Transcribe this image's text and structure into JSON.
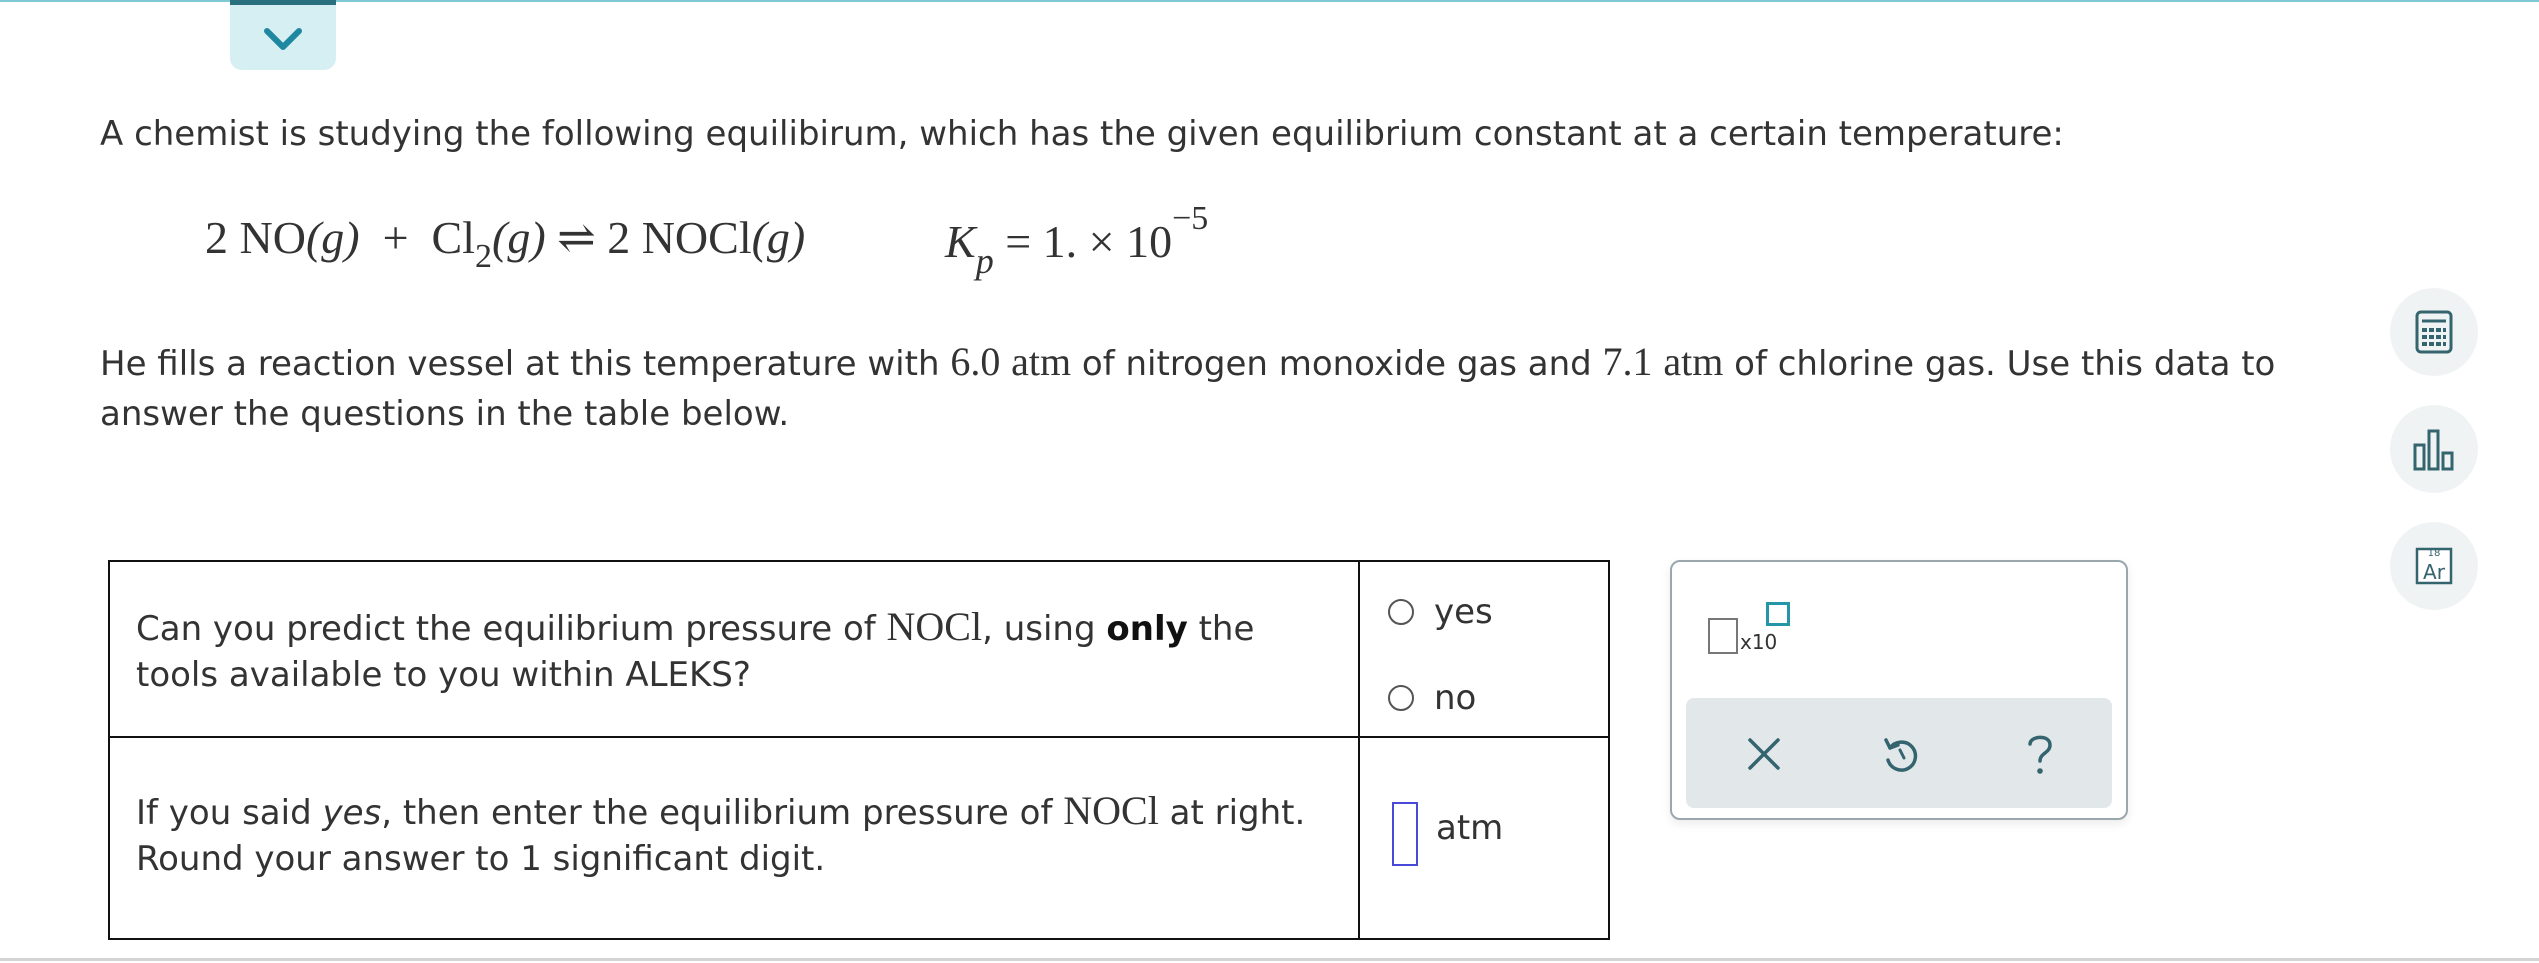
{
  "problem": {
    "intro": "A chemist is studying the following equilibirum, which has the given equilibrium constant at a certain temperature:",
    "equation": {
      "coef1": "2",
      "reactant1": "NO",
      "state1": "(g)",
      "plus": "+",
      "reactant2": "Cl",
      "reactant2_sub": "2",
      "state2": "(g)",
      "arrow": "⇌",
      "coef3": "2",
      "product": "NOCl",
      "state3": "(g)"
    },
    "kp": {
      "symbol": "K",
      "symbol_sub": "p",
      "value": "= 1. × 10",
      "exponent": "−5"
    },
    "para": {
      "part1": "He fills a reaction vessel at this temperature with ",
      "amount1": "6.0",
      "unit1": "atm",
      "part2": " of nitrogen monoxide gas and ",
      "amount2": "7.1",
      "unit2": "atm",
      "part3": " of chlorine gas. Use this data to answer the questions in the table below."
    }
  },
  "table": {
    "q1": {
      "text_a": "Can you predict the equilibrium pressure of ",
      "species": "NOCl",
      "text_b": ", using ",
      "emph": "only",
      "text_c": " the tools available to you within ALEKS?",
      "options": [
        "yes",
        "no"
      ]
    },
    "q2": {
      "text_a": "If you said ",
      "emph": "yes",
      "text_b": ", then enter the equilibrium pressure of ",
      "species": "NOCl",
      "text_c": " at right. Round your answer to 1 significant digit.",
      "input_value": "",
      "unit": "atm"
    }
  },
  "toolpanel": {
    "sci_label": "x10"
  },
  "sidebar": {
    "periodic_number": "18",
    "periodic_symbol": "Ar"
  },
  "colors": {
    "accent": "#2596a8",
    "tab_bg": "#d6eff3",
    "input_border": "#4a4ad8",
    "action_bar": "#e2e7ea"
  }
}
